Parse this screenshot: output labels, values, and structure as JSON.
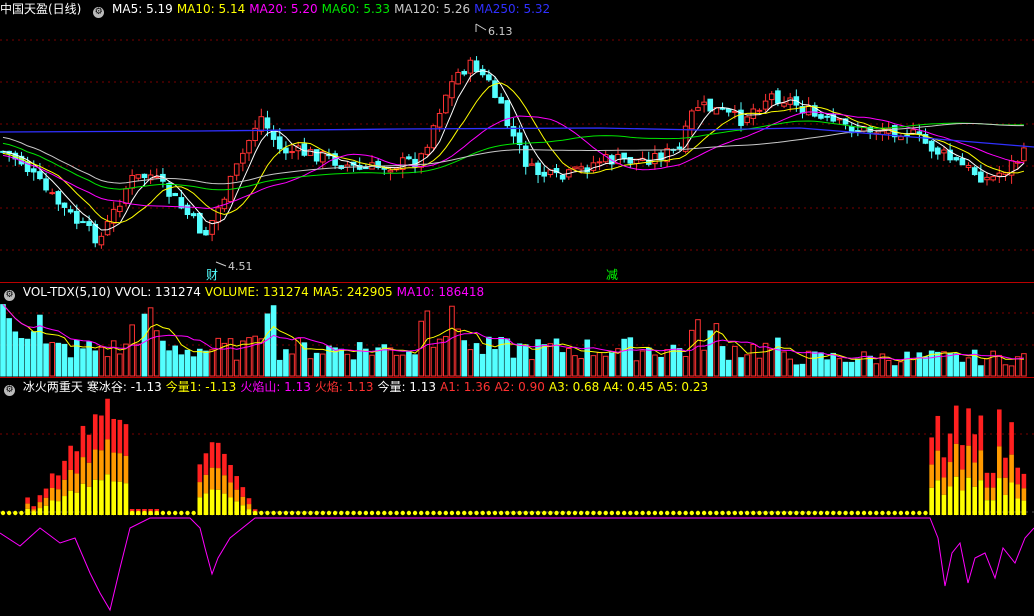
{
  "colors": {
    "up": "#ff3232",
    "down": "#54ffff",
    "grid": "#7a0000",
    "ma5": "#ffffff",
    "ma10": "#ffff00",
    "ma20": "#ff00ff",
    "ma60": "#00e600",
    "ma120": "#c8c8c8",
    "ma250": "#3030ff",
    "vol_ma5": "#ffff00",
    "vol_ma10": "#ff00ff"
  },
  "price_panel": {
    "icon": "gear-icon",
    "title": "中国天盈(日线)",
    "legend": [
      {
        "label": "MA5: 5.19",
        "color": "#ffffff"
      },
      {
        "label": "MA10: 5.14",
        "color": "#ffff00"
      },
      {
        "label": "MA20: 5.20",
        "color": "#ff00ff"
      },
      {
        "label": "MA60: 5.33",
        "color": "#00e600"
      },
      {
        "label": "MA120: 5.26",
        "color": "#c8c8c8"
      },
      {
        "label": "MA250: 5.32",
        "color": "#3030ff"
      }
    ],
    "high_label": "6.13",
    "low_label": "4.51",
    "marker_cai": "财",
    "marker_jian": "减"
  },
  "volume_panel": {
    "icon": "gear-icon",
    "legend": [
      {
        "label": "VOL-TDX(5,10)",
        "color": "#ffffff"
      },
      {
        "label": "VVOL: 131274",
        "color": "#ffffff"
      },
      {
        "label": "VOLUME: 131274",
        "color": "#ffff00"
      },
      {
        "label": "MA5: 242905",
        "color": "#ffff00"
      },
      {
        "label": "MA10: 186418",
        "color": "#ff00ff"
      }
    ]
  },
  "indicator_panel": {
    "icon": "gear-icon",
    "legend": [
      {
        "label": "冰火两重天",
        "color": "#ffffff"
      },
      {
        "label": "寒冰谷: -1.13",
        "color": "#ffffff"
      },
      {
        "label": "今量1: -1.13",
        "color": "#ffff00"
      },
      {
        "label": "火焰山: 1.13",
        "color": "#ff00ff"
      },
      {
        "label": "火焰: 1.13",
        "color": "#ff3232"
      },
      {
        "label": "今量: 1.13",
        "color": "#ffffff"
      },
      {
        "label": "A1: 1.36",
        "color": "#ff3232"
      },
      {
        "label": "A2: 0.90",
        "color": "#ff3232"
      },
      {
        "label": "A3: 0.68",
        "color": "#ffff00"
      },
      {
        "label": "A4: 0.45",
        "color": "#ffff00"
      },
      {
        "label": "A5: 0.23",
        "color": "#ffff00"
      }
    ]
  }
}
